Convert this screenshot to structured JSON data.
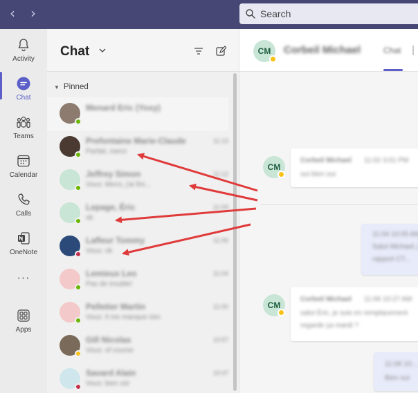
{
  "titlebar": {
    "back_arrow": "‹",
    "forward_arrow": "›",
    "search_placeholder": "Search"
  },
  "rail": {
    "items": [
      {
        "label": "Activity",
        "icon": "bell-icon"
      },
      {
        "label": "Chat",
        "icon": "chat-icon"
      },
      {
        "label": "Teams",
        "icon": "teams-icon"
      },
      {
        "label": "Calendar",
        "icon": "calendar-icon"
      },
      {
        "label": "Calls",
        "icon": "phone-icon"
      },
      {
        "label": "OneNote",
        "icon": "onenote-icon"
      },
      {
        "label": "···",
        "icon": "more-icon"
      },
      {
        "label": "Apps",
        "icon": "apps-icon"
      }
    ],
    "active": "Chat"
  },
  "chatlist": {
    "title": "Chat",
    "section": "Pinned",
    "contacts": [
      {
        "name": "Menard Eric (Yoxy)",
        "preview": "",
        "time": "",
        "status": "#6bb700",
        "avatar": "#8c7b6e"
      },
      {
        "name": "Prefontaine Marie-Claude",
        "preview": "Parfait, merci",
        "time": "11:13",
        "status": "#6bb700",
        "avatar": "#4a3a32"
      },
      {
        "name": "Jeffrey Simon",
        "preview": "Vous: Merci, j'ai fini...",
        "time": "11:12",
        "status": "#6bb700",
        "avatar": "#c8e5d6"
      },
      {
        "name": "Lepage, Éric",
        "preview": "ok",
        "time": "11:09",
        "status": "#6bb700",
        "avatar": "#c8e5d6"
      },
      {
        "name": "Lafleur Tommy",
        "preview": "Vous: ok",
        "time": "11:06",
        "status": "#c4314b",
        "avatar": "#2b4a7a"
      },
      {
        "name": "Lemieux Leo",
        "preview": "Pas de trouble!",
        "time": "11:04",
        "status": "#6bb700",
        "avatar": "#f3c9c9"
      },
      {
        "name": "Pelletier Martin",
        "preview": "Vous: Il me manque rien",
        "time": "11:00",
        "status": "#6bb700",
        "avatar": "#f3c9c9"
      },
      {
        "name": "Gill Nicolas",
        "preview": "Vous: of course",
        "time": "10:57",
        "status": "#f8c21b",
        "avatar": "#7a6a5a"
      },
      {
        "name": "Savard Alain",
        "preview": "Vous: bien sûr",
        "time": "10:47",
        "status": "#c4314b",
        "avatar": "#cfe7ec"
      }
    ]
  },
  "conversation": {
    "initials": "CM",
    "name": "Corbeil Michael",
    "tab_label": "Chat",
    "messages": [
      {
        "sender": "Corbeil Michael",
        "time": "11:02 3:01 PM",
        "text": "oui bien oui",
        "mine": false
      },
      {
        "sender": "",
        "time": "11:04 10:05 AM",
        "text": "Salut Michael, je suis...",
        "extra": "rapport CT...",
        "mine": true
      },
      {
        "sender": "Corbeil Michael",
        "time": "11:06 10:27 AM",
        "text": "salut Éric, je suis en remplacement",
        "extra": "regarde ça mardi ?",
        "mine": false
      },
      {
        "sender": "",
        "time": "11:08 10:...",
        "text": "Bien sur",
        "mine": true
      }
    ]
  },
  "colors": {
    "titlebar": "#464775",
    "accent": "#5b5fc7",
    "annotation_arrow": "#e03b3b"
  }
}
